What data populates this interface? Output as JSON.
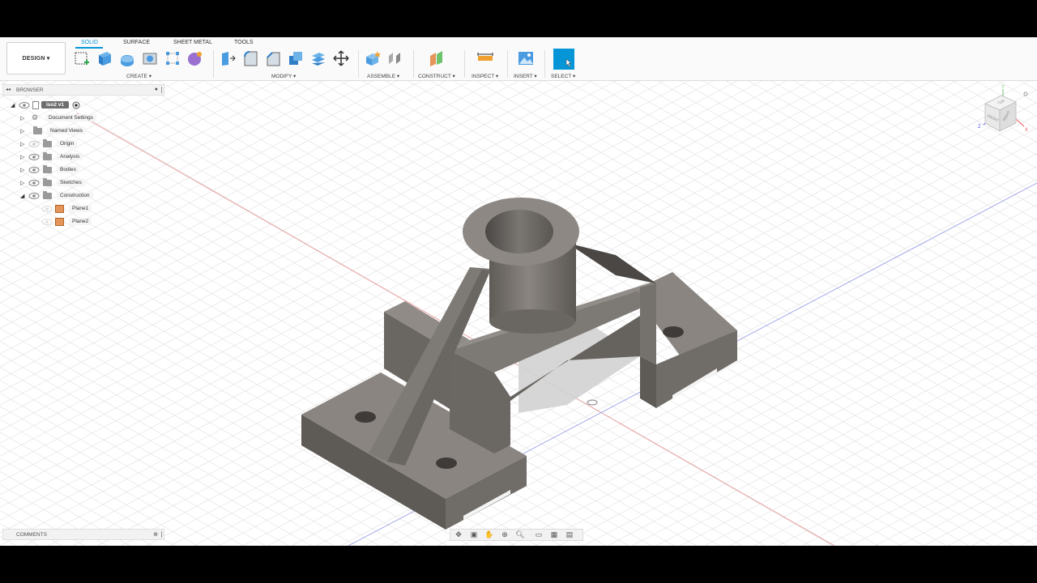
{
  "app": {
    "workspace_button": "DESIGN ▾",
    "tabs": [
      "SOLID",
      "SURFACE",
      "SHEET METAL",
      "TOOLS"
    ],
    "active_tab": "SOLID",
    "groups": {
      "create": "CREATE ▾",
      "modify": "MODIFY ▾",
      "assemble": "ASSEMBLE ▾",
      "construct": "CONSTRUCT ▾",
      "inspect": "INSPECT ▾",
      "insert": "INSERT ▾",
      "select": "SELECT ▾"
    }
  },
  "browser": {
    "title": "BROWSER",
    "root": "iso2 v1",
    "items": [
      {
        "label": "Document Settings",
        "icon": "gear-icon"
      },
      {
        "label": "Named Views",
        "icon": "folder-icon"
      },
      {
        "label": "Origin",
        "icon": "folder-icon"
      },
      {
        "label": "Analysis",
        "icon": "folder-icon"
      },
      {
        "label": "Bodies",
        "icon": "folder-icon"
      },
      {
        "label": "Sketches",
        "icon": "folder-icon"
      },
      {
        "label": "Construction",
        "icon": "folder-icon"
      }
    ],
    "planes": [
      "Plane1",
      "Plane2"
    ]
  },
  "comments": {
    "title": "COMMENTS"
  },
  "viewcube": {
    "top": "TOP",
    "front": "FRONT",
    "right": "RIGHT",
    "axis_x": "X",
    "axis_y": "Y",
    "axis_z": "Z"
  },
  "colors": {
    "accent": "#0696d7",
    "model": "#6f6b66",
    "grid": "#e3e3e3"
  }
}
